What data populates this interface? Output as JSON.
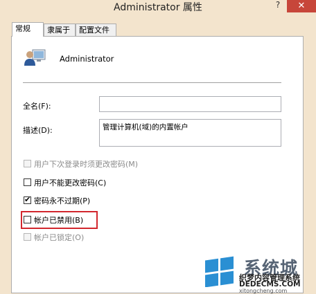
{
  "window": {
    "title": "Administrator 属性",
    "help_glyph": "?",
    "close_glyph": "✕"
  },
  "tabs": [
    {
      "label": "常规",
      "active": true
    },
    {
      "label": "隶属于",
      "active": false
    },
    {
      "label": "配置文件",
      "active": false
    }
  ],
  "general": {
    "username": "Administrator",
    "fullname_label": "全名(F):",
    "fullname_value": "",
    "description_label": "描述(D):",
    "description_value": "管理计算机(域)的内置帐户"
  },
  "options": [
    {
      "label": "用户下次登录时须更改密码(M)",
      "checked": false,
      "enabled": false
    },
    {
      "label": "用户不能更改密码(C)",
      "checked": false,
      "enabled": true
    },
    {
      "label": "密码永不过期(P)",
      "checked": true,
      "enabled": true
    },
    {
      "label": "帐户已禁用(B)",
      "checked": false,
      "enabled": true,
      "highlighted": true
    },
    {
      "label": "帐户已锁定(O)",
      "checked": false,
      "enabled": false
    }
  ],
  "watermark": {
    "brand": "系统城",
    "line1": "织梦内容管理系统",
    "line2": "DEDECMS.COM",
    "line3": "xitongcheng.com"
  },
  "colors": {
    "highlight_box": "#d2262d",
    "close_button": "#c7463a",
    "window_frame": "#f3e4cd"
  }
}
